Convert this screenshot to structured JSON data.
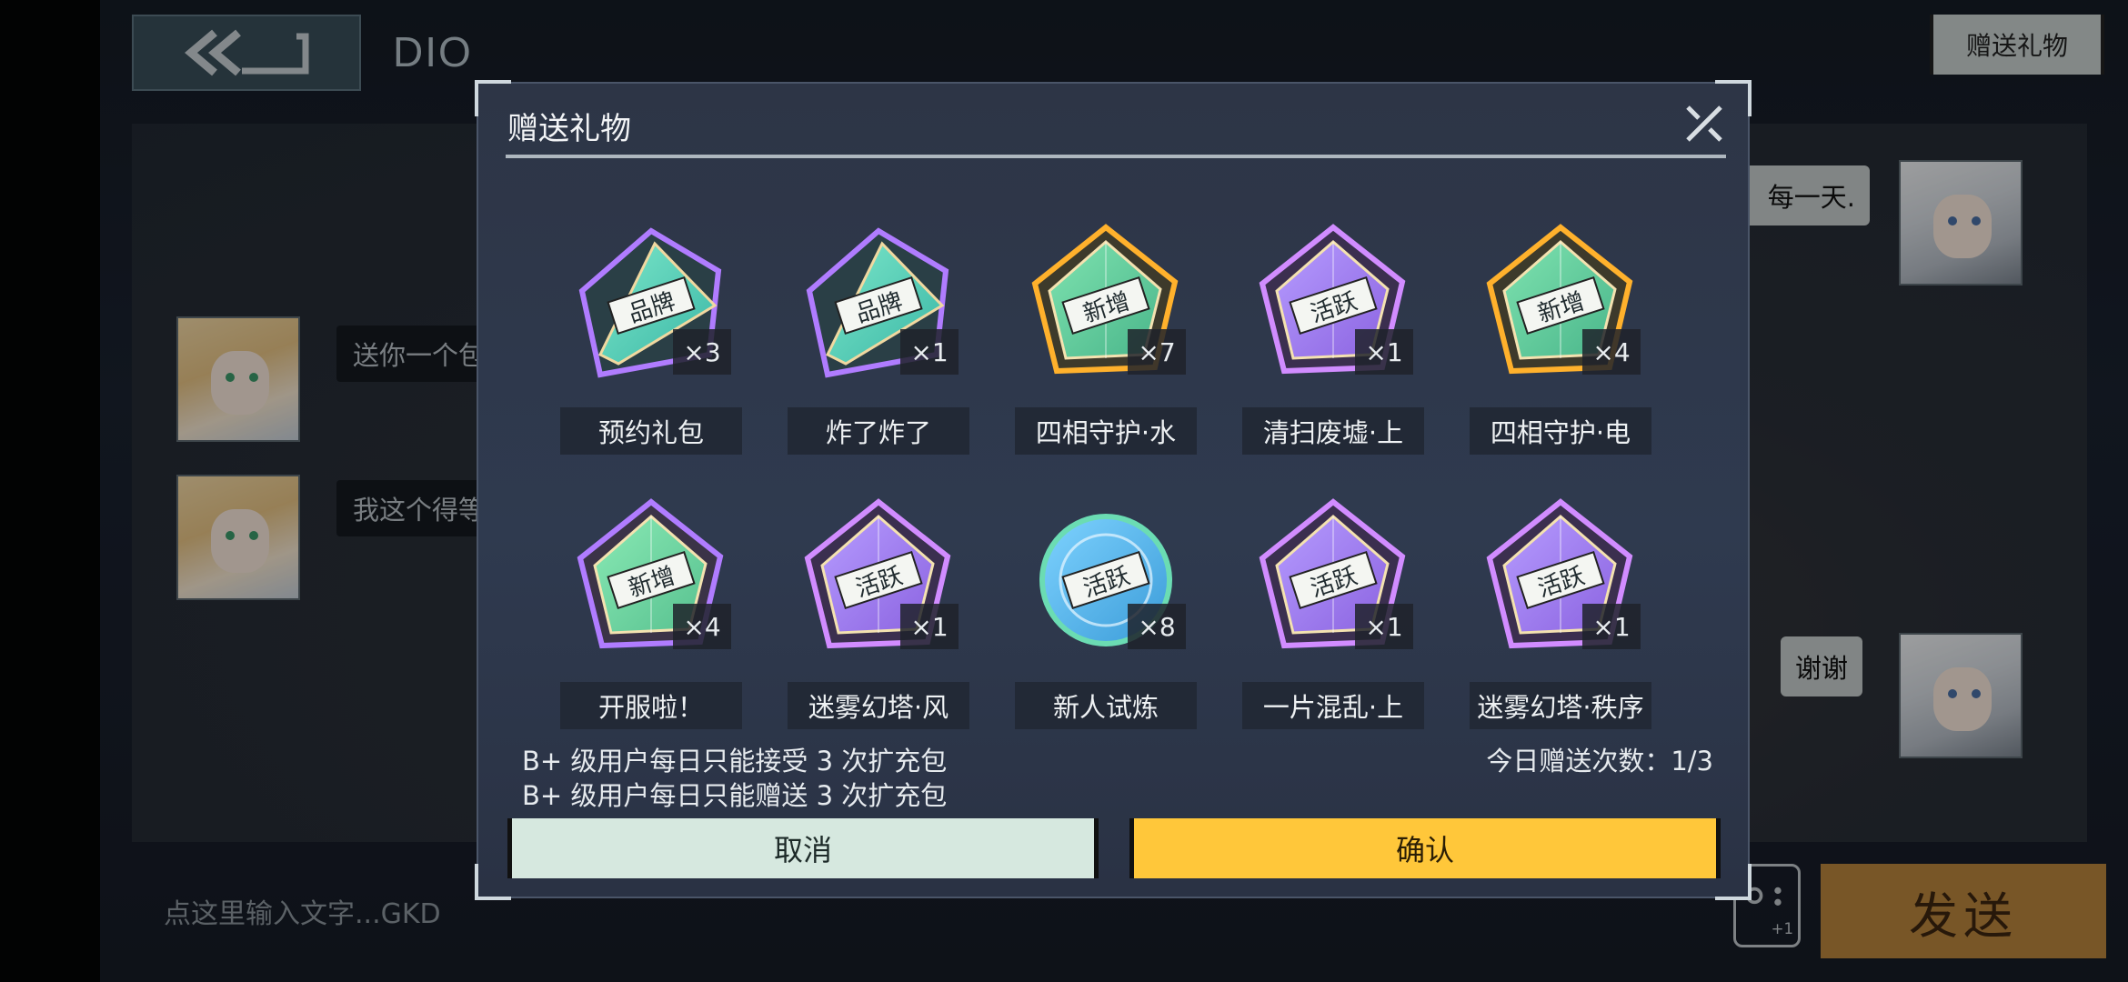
{
  "header": {
    "page_title": "DIO",
    "gift_button_label": "赠送礼物"
  },
  "chat": {
    "left_messages": [
      "送你一个包",
      "我这个得等"
    ],
    "right_messages": [
      "每一天.",
      "谢谢"
    ],
    "input_placeholder": "点这里输入文字...GKD",
    "send_label": "发送",
    "game_badge": "+1"
  },
  "modal": {
    "title": "赠送礼物",
    "items": [
      {
        "tag": "品牌",
        "qty": "×3",
        "label": "预约礼包",
        "style": "brand-teal"
      },
      {
        "tag": "品牌",
        "qty": "×1",
        "label": "炸了炸了",
        "style": "brand-teal"
      },
      {
        "tag": "新增",
        "qty": "×7",
        "label": "四相守护·水",
        "style": "new-gold"
      },
      {
        "tag": "活跃",
        "qty": "×1",
        "label": "清扫废墟·上",
        "style": "active-purple"
      },
      {
        "tag": "新增",
        "qty": "×4",
        "label": "四相守护·电",
        "style": "new-gold"
      },
      {
        "tag": "新增",
        "qty": "×4",
        "label": "开服啦！",
        "style": "new-green"
      },
      {
        "tag": "活跃",
        "qty": "×1",
        "label": "迷雾幻塔·风",
        "style": "active-purple"
      },
      {
        "tag": "活跃",
        "qty": "×8",
        "label": "新人试炼",
        "style": "active-blue"
      },
      {
        "tag": "活跃",
        "qty": "×1",
        "label": "一片混乱·上",
        "style": "active-purple"
      },
      {
        "tag": "活跃",
        "qty": "×1",
        "label": "迷雾幻塔·秩序",
        "style": "active-purple"
      }
    ],
    "notes": [
      "B+ 级用户每日只能接受 3 次扩充包",
      "B+ 级用户每日只能赠送 3 次扩充包"
    ],
    "daily_count": "今日赠送次数：1/3",
    "cancel_label": "取消",
    "confirm_label": "确认"
  },
  "colors": {
    "confirm": "#ffc73a",
    "cancel": "#d6e8df",
    "send": "#b9853c"
  }
}
